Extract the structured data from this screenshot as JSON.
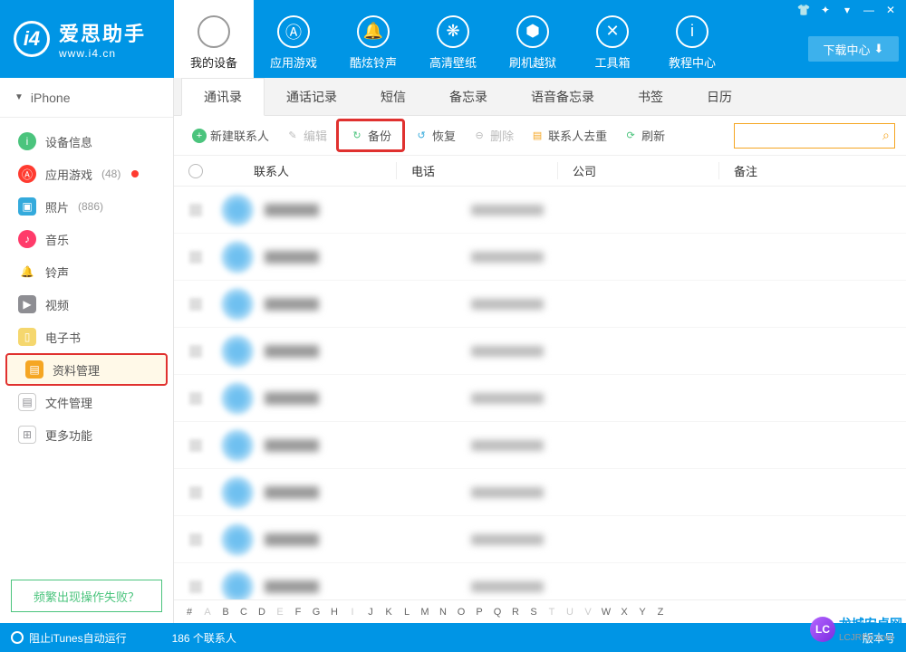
{
  "brand": {
    "title": "爱思助手",
    "subtitle": "www.i4.cn",
    "logo_letter": "i4"
  },
  "win": {
    "shirt": "👕",
    "gear": "✦",
    "tips": "▾",
    "min": "—",
    "close": "✕"
  },
  "download_center": "下载中心",
  "top_nav": [
    {
      "label": "我的设备",
      "icon": ""
    },
    {
      "label": "应用游戏",
      "icon": "Ⓐ"
    },
    {
      "label": "酷炫铃声",
      "icon": "🔔"
    },
    {
      "label": "高清壁纸",
      "icon": "❋"
    },
    {
      "label": "刷机越狱",
      "icon": "⬢"
    },
    {
      "label": "工具箱",
      "icon": "✕"
    },
    {
      "label": "教程中心",
      "icon": "i"
    }
  ],
  "device_name": "iPhone",
  "sidebar": [
    {
      "key": "info",
      "label": "设备信息",
      "icon": "i",
      "color": "#4bc47d"
    },
    {
      "key": "apps",
      "label": "应用游戏",
      "icon": "Ⓐ",
      "color": "#ff3b30",
      "count": "(48)",
      "dot": true
    },
    {
      "key": "photos",
      "label": "照片",
      "icon": "▣",
      "color": "#34aadc",
      "count": "(886)"
    },
    {
      "key": "music",
      "label": "音乐",
      "icon": "♪",
      "color": "#ff3b6a"
    },
    {
      "key": "ring",
      "label": "铃声",
      "icon": "🔔",
      "color": "#34aadc"
    },
    {
      "key": "video",
      "label": "视频",
      "icon": "▶",
      "color": "#8e8e93"
    },
    {
      "key": "ebook",
      "label": "电子书",
      "icon": "▯",
      "color": "#f5a623"
    },
    {
      "key": "data",
      "label": "资料管理",
      "icon": "▤",
      "color": "#f5a623"
    },
    {
      "key": "files",
      "label": "文件管理",
      "icon": "▤",
      "color": "#8e8e93"
    },
    {
      "key": "more",
      "label": "更多功能",
      "icon": "⊞",
      "color": "#8e8e93"
    }
  ],
  "help_button": "频繁出现操作失败？",
  "sub_tabs": [
    "通讯录",
    "通话记录",
    "短信",
    "备忘录",
    "语音备忘录",
    "书签",
    "日历"
  ],
  "toolbar": {
    "new": "新建联系人",
    "edit": "编辑",
    "backup": "备份",
    "restore": "恢复",
    "delete": "删除",
    "dedupe": "联系人去重",
    "refresh": "刷新"
  },
  "table": {
    "headers": {
      "contact": "联系人",
      "phone": "电话",
      "company": "公司",
      "note": "备注"
    }
  },
  "alpha": [
    "#",
    "A",
    "B",
    "C",
    "D",
    "E",
    "F",
    "G",
    "H",
    "I",
    "J",
    "K",
    "L",
    "M",
    "N",
    "O",
    "P",
    "Q",
    "R",
    "S",
    "T",
    "U",
    "V",
    "W",
    "X",
    "Y",
    "Z"
  ],
  "alpha_dim": [
    "A",
    "E",
    "I",
    "T",
    "U",
    "V"
  ],
  "status": {
    "itunes": "阻止iTunes自动运行",
    "count": "186 个联系人",
    "version": "版本号"
  },
  "watermark": {
    "name": "龙城安卓网",
    "url": "LCJRFG.com",
    "badge": "LC"
  }
}
